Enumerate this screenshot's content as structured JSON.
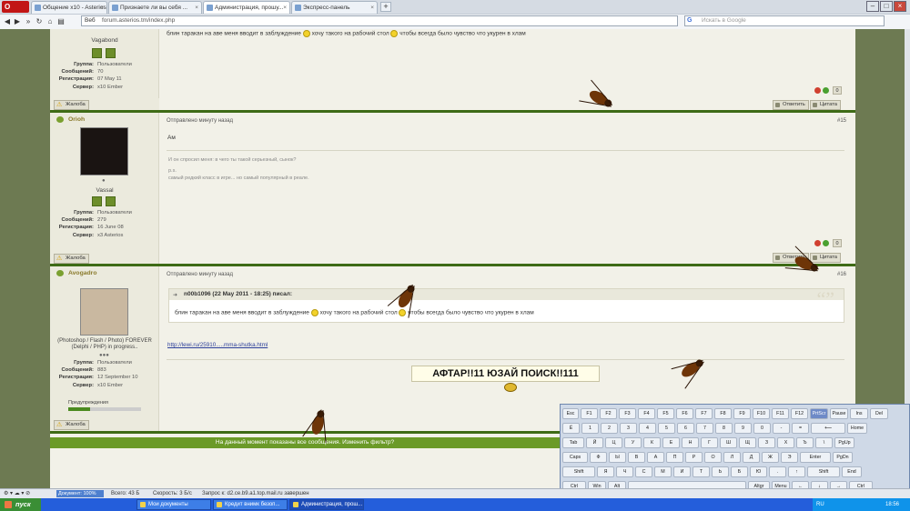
{
  "browser": {
    "logo": "O",
    "tabs": [
      {
        "label": "Общение x10 - Asterios",
        "active": false
      },
      {
        "label": "Признаете ли вы себя ...",
        "active": false
      },
      {
        "label": "Администрация, прошу...",
        "active": true
      },
      {
        "label": "Экспресс-панель",
        "active": false
      }
    ],
    "web_label": "Веб",
    "url": "forum.asterios.tm/index.php",
    "search_placeholder": "Искать в Google",
    "search_engine": "G"
  },
  "posts": [
    {
      "username": "Vagabond",
      "title": "",
      "info": [
        {
          "k": "Группа:",
          "v": "Пользователи"
        },
        {
          "k": "Сообщений:",
          "v": "70"
        },
        {
          "k": "Регистрация:",
          "v": "07 May 11"
        },
        {
          "k": "Сервер:",
          "v": "x10 Ember"
        }
      ],
      "text": "блин таракан на аве меня вводит в заблуждение",
      "text2": "хочу такого на рабочий стол",
      "text3": "чтобы всегда было чувство что укурен в хлам",
      "rating": "0"
    },
    {
      "username": "Orioh",
      "title": "Vassal",
      "meta": "Отправлено минуту назад",
      "number": "#15",
      "text": "Ам",
      "sig1": "И он спросил меня: в чего ты такой серьезный, сынок?",
      "sig2": "p.s.",
      "sig3": "самый редкий класс в игре... но самый популярный в реале.",
      "info": [
        {
          "k": "Группа:",
          "v": "Пользователи"
        },
        {
          "k": "Сообщений:",
          "v": "279"
        },
        {
          "k": "Регистрация:",
          "v": "16 June 08"
        },
        {
          "k": "Сервер:",
          "v": "x3 Asterios"
        }
      ],
      "rating": "0"
    },
    {
      "username": "Avogadro",
      "title": "(Photoshop / Flash / Photo) FOREVER (Delphi / PHP) in progress..",
      "meta": "Отправлено минуту назад",
      "number": "#16",
      "quote_header": "n00b1096 (22 May 2011 - 18:25) писал:",
      "quote_text": "блин таракан на аве меня вводит в заблуждение",
      "quote_text2": "хочу такого на рабочий стол",
      "quote_text3": "чтобы всегда было чувство что укурен в хлам",
      "link": "http://lewi.ru/25910.....mma-shutka.html",
      "info": [
        {
          "k": "Группа:",
          "v": "Пользователи"
        },
        {
          "k": "Сообщений:",
          "v": "883"
        },
        {
          "k": "Регистрация:",
          "v": "12 September 10"
        },
        {
          "k": "Сервер:",
          "v": "x10 Ember"
        }
      ],
      "warnings_label": "Предупреждения"
    }
  ],
  "buttons": {
    "report": "Жалоба",
    "reply": "Ответить",
    "quote": "Цитата"
  },
  "filter_text": "На данный момент показаны все сообщения. Изменить фильтр?",
  "overlay_text": "АФТАР!!11 ЮЗАЙ ПОИСК!!111",
  "statusbar": {
    "doc_label": "Документ: 100%",
    "total": "Всего: 43 Б",
    "speed": "Скорость: 3 Б/с",
    "request": "Запрос к: d2.ce.b9.a1.top.mail.ru завершен"
  },
  "keyboard": {
    "rows": [
      [
        "Esc",
        "F1",
        "F2",
        "F3",
        "F4",
        "F5",
        "F6",
        "F7",
        "F8",
        "F9",
        "F10",
        "F11",
        "F12",
        "PrtScr",
        "Pause",
        "Ins",
        "Del"
      ],
      [
        "Ё",
        "1",
        "2",
        "3",
        "4",
        "5",
        "6",
        "7",
        "8",
        "9",
        "0",
        "-",
        "=",
        "⟵",
        "Home"
      ],
      [
        "Tab",
        "Й",
        "Ц",
        "У",
        "К",
        "Е",
        "Н",
        "Г",
        "Ш",
        "Щ",
        "З",
        "Х",
        "Ъ",
        "\\",
        "PgUp"
      ],
      [
        "Caps",
        "Ф",
        "Ы",
        "В",
        "А",
        "П",
        "Р",
        "О",
        "Л",
        "Д",
        "Ж",
        "Э",
        "Enter",
        "PgDn"
      ],
      [
        "Shift",
        "Я",
        "Ч",
        "С",
        "М",
        "И",
        "Т",
        "Ь",
        "Б",
        "Ю",
        ".",
        "↑",
        "Shift",
        "End"
      ],
      [
        "Ctrl",
        "Win",
        "Alt",
        "",
        "Altgr",
        "Menu",
        "←",
        "↓",
        "→",
        "Ctrl"
      ]
    ]
  },
  "taskbar": {
    "start": "пуск",
    "tasks": [
      {
        "label": "Мои документы"
      },
      {
        "label": "Кредит внимк безоп..."
      },
      {
        "label": "Администрация, прош..."
      }
    ],
    "lang": "RU",
    "clock": "18:56"
  }
}
